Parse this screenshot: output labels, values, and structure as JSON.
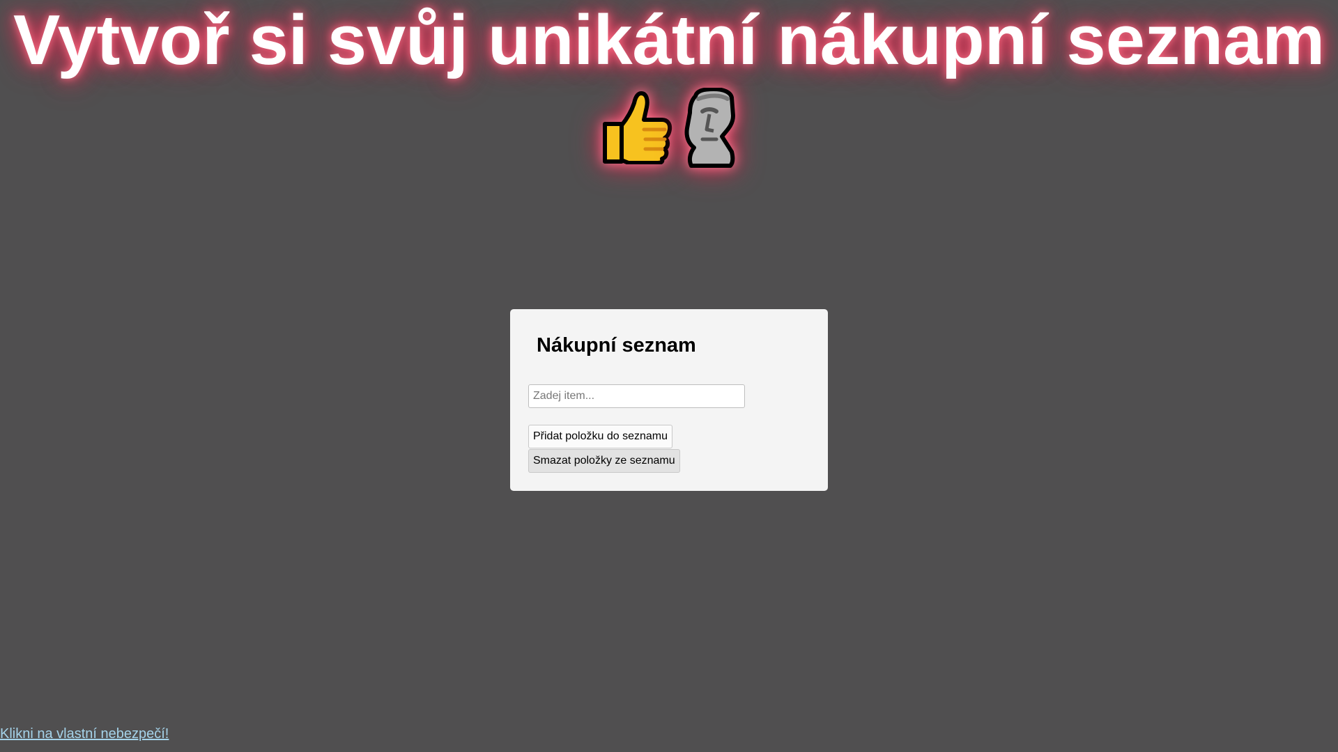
{
  "header": {
    "title": "Vytvoř si svůj unikátní nákupní seznam",
    "emojis": [
      {
        "name": "thumbs-up-icon",
        "char": "👍"
      },
      {
        "name": "moai-icon",
        "char": "🗿"
      }
    ],
    "glow_color": "#e83a5c"
  },
  "card": {
    "title": "Nákupní seznam",
    "input": {
      "placeholder": "Zadej item...",
      "value": ""
    },
    "add_button_label": "Přidat položku do seznamu",
    "clear_button_label": "Smazat položky ze seznamu"
  },
  "footer": {
    "link_text": "Klikni na vlastní nebezpečí!"
  },
  "colors": {
    "background": "#504f50",
    "card": "#f4f4f4",
    "link": "#a5d3ea"
  }
}
